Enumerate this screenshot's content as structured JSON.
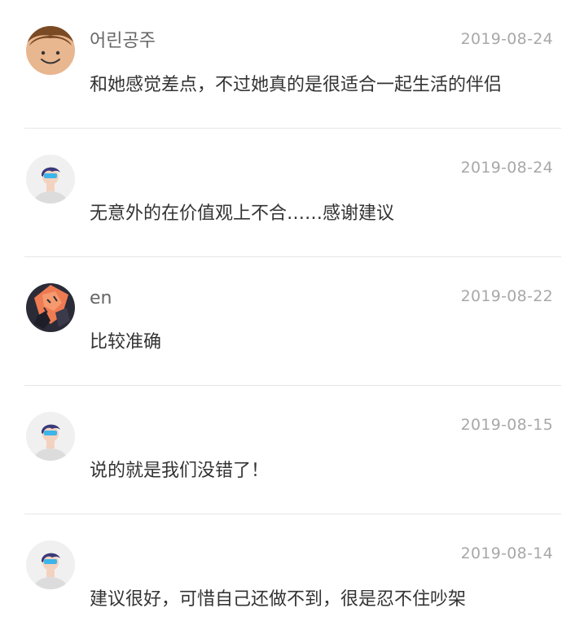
{
  "comments": [
    {
      "avatar": "face-avatar",
      "username": "어린공주",
      "date": "2019-08-24",
      "text": "和她感觉差点，不过她真的是很适合一起生活的伴侣"
    },
    {
      "avatar": "default-avatar",
      "username": "",
      "date": "2019-08-24",
      "text": "无意外的在价值观上不合……感谢建议"
    },
    {
      "avatar": "artwork-avatar",
      "username": "en",
      "date": "2019-08-22",
      "text": "比较准确"
    },
    {
      "avatar": "default-avatar",
      "username": "",
      "date": "2019-08-15",
      "text": "说的就是我们没错了！"
    },
    {
      "avatar": "default-avatar",
      "username": "",
      "date": "2019-08-14",
      "text": "建议很好，可惜自己还做不到，很是忍不住吵架"
    }
  ]
}
